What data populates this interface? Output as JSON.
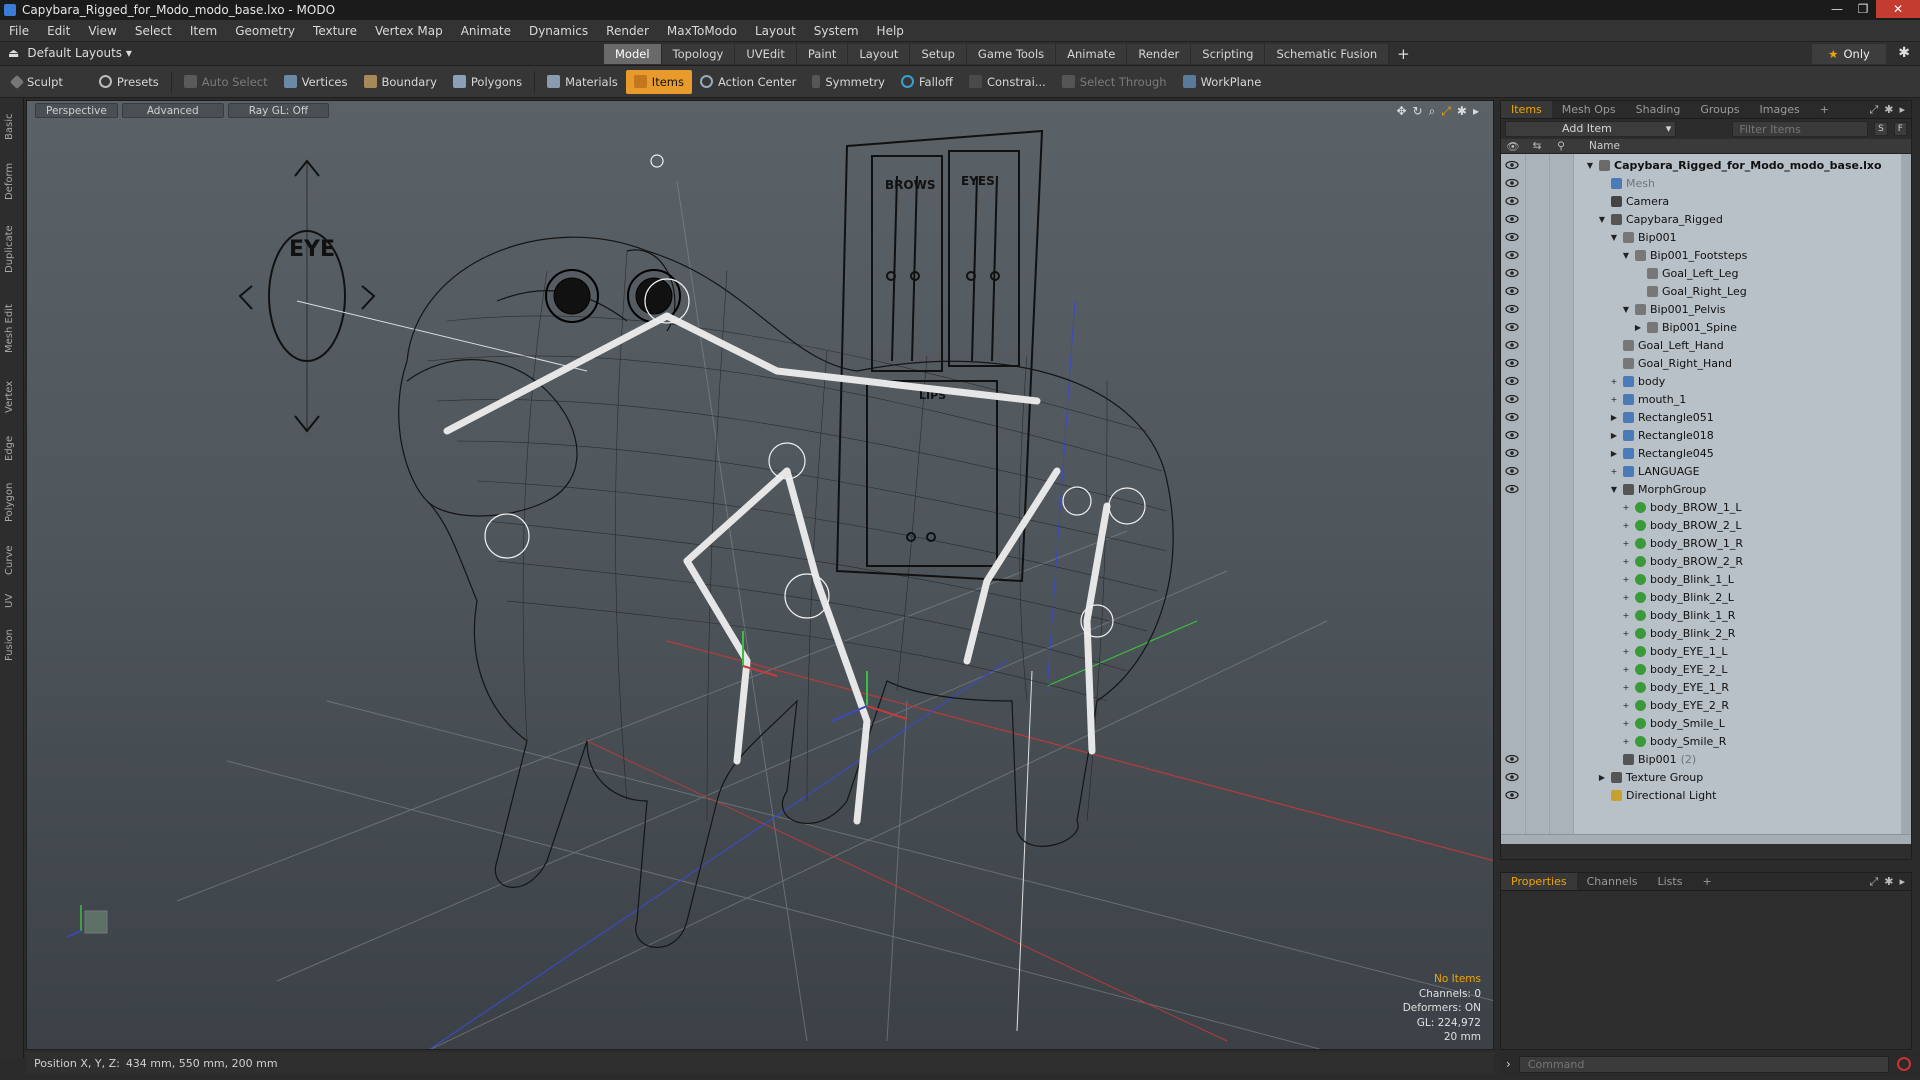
{
  "window": {
    "title": "Capybara_Rigged_for_Modo_modo_base.lxo - MODO"
  },
  "menu": [
    "File",
    "Edit",
    "View",
    "Select",
    "Item",
    "Geometry",
    "Texture",
    "Vertex Map",
    "Animate",
    "Dynamics",
    "Render",
    "MaxToModo",
    "Layout",
    "System",
    "Help"
  ],
  "layout": {
    "selector": "Default Layouts",
    "tabs": [
      "Model",
      "Topology",
      "UVEdit",
      "Paint",
      "Layout",
      "Setup",
      "Game Tools",
      "Animate",
      "Render",
      "Scripting",
      "Schematic Fusion"
    ],
    "active_tab": "Model",
    "only_label": "Only"
  },
  "toolbar": {
    "sculpt": "Sculpt",
    "presets": "Presets",
    "auto_select": "Auto Select",
    "vertices": "Vertices",
    "boundary": "Boundary",
    "polygons": "Polygons",
    "materials": "Materials",
    "items": "Items",
    "action_center": "Action Center",
    "symmetry": "Symmetry",
    "falloff": "Falloff",
    "constraints": "Constrai...",
    "select_through": "Select Through",
    "workplane": "WorkPlane"
  },
  "left_tabs": [
    "Basic",
    "Deform",
    "Duplicate",
    "Mesh Edit",
    "Vertex",
    "Edge",
    "Polygon",
    "Curve",
    "UV",
    "Fusion"
  ],
  "viewport": {
    "view_mode": "Perspective",
    "shading": "Advanced",
    "raygl": "Ray GL: Off",
    "scene_labels": {
      "eye": "EYE",
      "brows": "BROWS",
      "eyes": "EYES",
      "lips": "LIPS"
    },
    "info": {
      "selection": "No Items",
      "channels": "Channels: 0",
      "deformers": "Deformers: ON",
      "gl": "GL: 224,972",
      "scale": "20 mm"
    }
  },
  "status": {
    "label": "Position X, Y, Z:",
    "value": "434 mm, 550 mm, 200 mm"
  },
  "items_panel": {
    "tabs": [
      "Items",
      "Mesh Ops",
      "Shading",
      "Groups",
      "Images"
    ],
    "active_tab": "Items",
    "add_item": "Add Item",
    "filter_placeholder": "Filter Items",
    "btn_s": "S",
    "btn_f": "F",
    "column_name": "Name",
    "rows": [
      {
        "label": "Capybara_Rigged_for_Modo_modo_base.lxo",
        "indent": 0,
        "type": "scene",
        "arrow": "▼",
        "eye": true
      },
      {
        "label": "Mesh",
        "indent": 1,
        "type": "mesh",
        "arrow": "",
        "eye": true,
        "dim": true
      },
      {
        "label": "Camera",
        "indent": 1,
        "type": "camera",
        "arrow": "",
        "eye": true
      },
      {
        "label": "Capybara_Rigged",
        "indent": 1,
        "type": "group",
        "arrow": "▼",
        "eye": true
      },
      {
        "label": "Bip001",
        "indent": 2,
        "type": "bone",
        "arrow": "▼",
        "eye": true
      },
      {
        "label": "Bip001_Footsteps",
        "indent": 3,
        "type": "bone",
        "arrow": "▼",
        "eye": true
      },
      {
        "label": "Goal_Left_Leg",
        "indent": 4,
        "type": "bone",
        "arrow": "",
        "eye": true
      },
      {
        "label": "Goal_Right_Leg",
        "indent": 4,
        "type": "bone",
        "arrow": "",
        "eye": true
      },
      {
        "label": "Bip001_Pelvis",
        "indent": 3,
        "type": "bone",
        "arrow": "▼",
        "eye": true
      },
      {
        "label": "Bip001_Spine",
        "indent": 4,
        "type": "bone",
        "arrow": "▶",
        "eye": true
      },
      {
        "label": "Goal_Left_Hand",
        "indent": 2,
        "type": "bone",
        "arrow": "",
        "eye": true
      },
      {
        "label": "Goal_Right_Hand",
        "indent": 2,
        "type": "bone",
        "arrow": "",
        "eye": true
      },
      {
        "label": "body",
        "indent": 2,
        "type": "mesh",
        "arrow": "+",
        "eye": true
      },
      {
        "label": "mouth_1",
        "indent": 2,
        "type": "mesh",
        "arrow": "+",
        "eye": true
      },
      {
        "label": "Rectangle051",
        "indent": 2,
        "type": "mesh",
        "arrow": "▶",
        "eye": true
      },
      {
        "label": "Rectangle018",
        "indent": 2,
        "type": "mesh",
        "arrow": "▶",
        "eye": true
      },
      {
        "label": "Rectangle045",
        "indent": 2,
        "type": "mesh",
        "arrow": "▶",
        "eye": true
      },
      {
        "label": "LANGUAGE",
        "indent": 2,
        "type": "mesh",
        "arrow": "+",
        "eye": true
      },
      {
        "label": "MorphGroup",
        "indent": 2,
        "type": "group",
        "arrow": "▼",
        "eye": true
      },
      {
        "label": "body_BROW_1_L",
        "indent": 3,
        "type": "morph",
        "arrow": "+",
        "eye": false
      },
      {
        "label": "body_BROW_2_L",
        "indent": 3,
        "type": "morph",
        "arrow": "+",
        "eye": false
      },
      {
        "label": "body_BROW_1_R",
        "indent": 3,
        "type": "morph",
        "arrow": "+",
        "eye": false
      },
      {
        "label": "body_BROW_2_R",
        "indent": 3,
        "type": "morph",
        "arrow": "+",
        "eye": false
      },
      {
        "label": "body_Blink_1_L",
        "indent": 3,
        "type": "morph",
        "arrow": "+",
        "eye": false
      },
      {
        "label": "body_Blink_2_L",
        "indent": 3,
        "type": "morph",
        "arrow": "+",
        "eye": false
      },
      {
        "label": "body_Blink_1_R",
        "indent": 3,
        "type": "morph",
        "arrow": "+",
        "eye": false
      },
      {
        "label": "body_Blink_2_R",
        "indent": 3,
        "type": "morph",
        "arrow": "+",
        "eye": false
      },
      {
        "label": "body_EYE_1_L",
        "indent": 3,
        "type": "morph",
        "arrow": "+",
        "eye": false
      },
      {
        "label": "body_EYE_2_L",
        "indent": 3,
        "type": "morph",
        "arrow": "+",
        "eye": false
      },
      {
        "label": "body_EYE_1_R",
        "indent": 3,
        "type": "morph",
        "arrow": "+",
        "eye": false
      },
      {
        "label": "body_EYE_2_R",
        "indent": 3,
        "type": "morph",
        "arrow": "+",
        "eye": false
      },
      {
        "label": "body_Smile_L",
        "indent": 3,
        "type": "morph",
        "arrow": "+",
        "eye": false
      },
      {
        "label": "body_Smile_R",
        "indent": 3,
        "type": "morph",
        "arrow": "+",
        "eye": false
      },
      {
        "label": "Bip001",
        "suffix": "(2)",
        "indent": 2,
        "type": "group",
        "arrow": "",
        "eye": true
      },
      {
        "label": "Texture Group",
        "indent": 1,
        "type": "group",
        "arrow": "▶",
        "eye": true
      },
      {
        "label": "Directional Light",
        "indent": 1,
        "type": "light",
        "arrow": "",
        "eye": true
      }
    ]
  },
  "properties_panel": {
    "tabs": [
      "Properties",
      "Channels",
      "Lists"
    ],
    "active_tab": "Properties"
  },
  "command": {
    "placeholder": "Command"
  },
  "colors": {
    "accent": "#f2a400",
    "items_active": "#e89a2c",
    "tree_bg": "#b8c0c8"
  }
}
